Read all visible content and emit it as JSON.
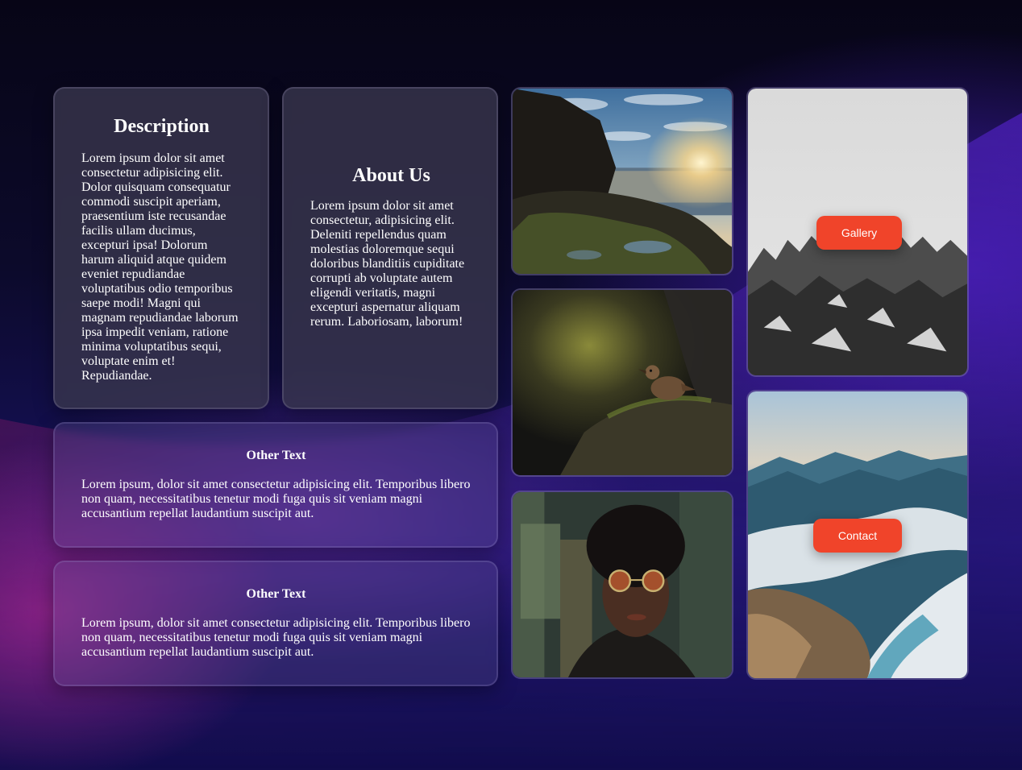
{
  "description": {
    "title": "Description",
    "text": "Lorem ipsum dolor sit amet consectetur adipisicing elit. Dolor quisquam consequatur commodi suscipit aperiam, praesentium iste recusandae facilis ullam ducimus, excepturi ipsa! Dolorum harum aliquid atque quidem eveniet repudiandae voluptatibus odio temporibus saepe modi! Magni qui magnam repudiandae laborum ipsa impedit veniam, ratione minima voluptatibus sequi, voluptate enim et! Repudiandae."
  },
  "about": {
    "title": "About Us",
    "text": "Lorem ipsum dolor sit amet consectetur, adipisicing elit. Deleniti repellendus quam molestias doloremque sequi doloribus blanditiis cupiditate corrupti ab voluptate autem eligendi veritatis, magni excepturi aspernatur aliquam rerum. Laboriosam, laborum!"
  },
  "other_cards": [
    {
      "title": "Other Text",
      "text": "Lorem ipsum, dolor sit amet consectetur adipisicing elit. Temporibus libero non quam, necessitatibus tenetur modi fuga quis sit veniam magni accusantium repellat laudantium suscipit aut."
    },
    {
      "title": "Other Text",
      "text": "Lorem ipsum, dolor sit amet consectetur adipisicing elit. Temporibus libero non quam, necessitatibus tenetur modi fuga quis sit veniam magni accusantium repellat laudantium suscipit aut."
    }
  ],
  "buttons": {
    "gallery": "Gallery",
    "contact": "Contact"
  },
  "colors": {
    "accent_button": "#f0442a",
    "background_deep": "#0c0a2b",
    "background_purple": "#4a1fb5"
  }
}
